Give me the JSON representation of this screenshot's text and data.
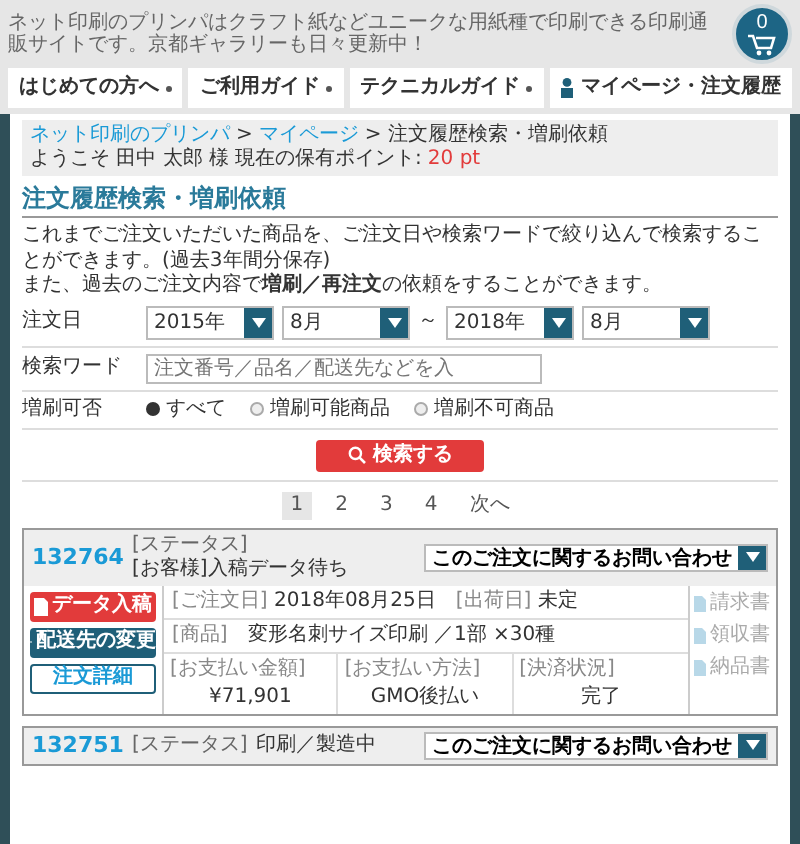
{
  "header": {
    "tagline": "ネット印刷のプリンパはクラフト紙などユニークな用紙種で印刷できる印刷通販サイトです。京都ギャラリーも日々更新中！",
    "nav": [
      {
        "label": "はじめての方へ",
        "kind": "dropdown"
      },
      {
        "label": "ご利用ガイド",
        "kind": "dropdown"
      },
      {
        "label": "テクニカルガイド",
        "kind": "dropdown"
      },
      {
        "label": "マイページ・注文履歴",
        "kind": "account"
      }
    ],
    "cart": {
      "count": "0"
    }
  },
  "breadcrumb": [
    {
      "label": "ネット印刷のプリンパ",
      "kind": "link"
    },
    {
      "label": "マイページ",
      "kind": "link"
    },
    {
      "label": "注文履歴検索・増刷依頼",
      "kind": "current"
    }
  ],
  "breadcrumb_separator": ">",
  "welcome": "ようこそ 田中 太郎 様",
  "points_label": "現在の保有ポイント:",
  "points": "20 pt",
  "title": "注文履歴検索・増刷依頼",
  "description": [
    "これまでご注文いただいた商品を、ご注文日や検索ワードで絞り込んで検索することができます。(過去3年間分保存)",
    "また、過去のご注文内容で**増刷／再注文**の依頼をすることができます。"
  ],
  "form": {
    "date": {
      "label": "注文日",
      "from_year": "2015年",
      "from_month": "8月",
      "separator": "～",
      "to_year": "2018年",
      "to_month": "8月"
    },
    "keyword": {
      "label": "検索ワード",
      "placeholder": "注文番号／品名／配送先などを入"
    },
    "reprint": {
      "label": "増刷可否",
      "options": [
        {
          "label": "すべて",
          "selected": true
        },
        {
          "label": "増刷可能商品",
          "selected": false
        },
        {
          "label": "増刷不可商品",
          "selected": false
        }
      ]
    },
    "submit": "検索する"
  },
  "pagination": [
    {
      "label": "1",
      "selected": true
    },
    {
      "label": "2",
      "selected": false
    },
    {
      "label": "3",
      "selected": false
    },
    {
      "label": "4",
      "selected": false
    },
    {
      "label": "次へ",
      "selected": false
    }
  ],
  "orders": [
    {
      "number": "132764",
      "status_label": "[ステータス]",
      "status": "[お客様]入稿データ待ち",
      "inquiry": "このご注文に関するお問い合わせ",
      "actions": [
        {
          "label": "データ入稿",
          "kind": "primary"
        },
        {
          "label": "配送先の変更",
          "kind": "secondary"
        },
        {
          "label": "注文詳細",
          "kind": "outline"
        }
      ],
      "order_date_label": "[ご注文日]",
      "order_date": "2018年08月25日",
      "ship_label": "[出荷日]",
      "ship_date": "未定",
      "product_label": "[商品]",
      "product": "変形名刺サイズ印刷 ／1部 ×30種",
      "payment": [
        {
          "label": "[お支払い金額]",
          "value": "¥71,901"
        },
        {
          "label": "[お支払い方法]",
          "value": "GMO後払い"
        },
        {
          "label": "[決済状況]",
          "value": "完了"
        }
      ],
      "documents": [
        {
          "label": "請求書",
          "disabled": true
        },
        {
          "label": "領収書",
          "disabled": true
        },
        {
          "label": "納品書",
          "disabled": true
        }
      ]
    },
    {
      "number": "132751",
      "status_label": "[ステータス]",
      "status": "印刷／製造中",
      "inquiry": "このご注文に関するお問い合わせ"
    }
  ]
}
